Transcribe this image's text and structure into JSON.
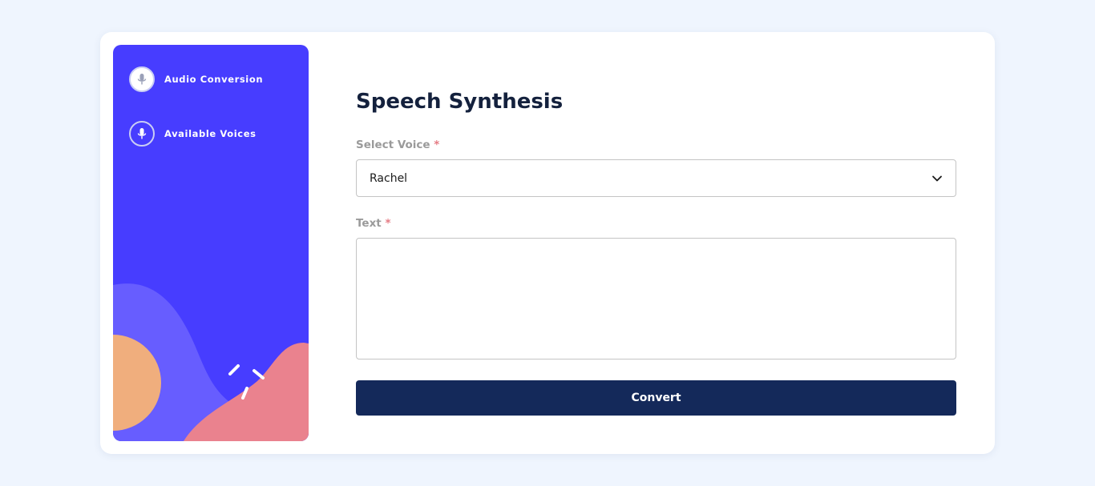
{
  "sidebar": {
    "items": [
      {
        "label": "Audio Conversion",
        "icon": "microphone-icon",
        "active": true
      },
      {
        "label": "Available Voices",
        "icon": "microphone-icon",
        "active": false
      }
    ]
  },
  "main": {
    "title": "Speech Synthesis",
    "voice_field": {
      "label": "Select Voice",
      "required_mark": "*",
      "value": "Rachel"
    },
    "text_field": {
      "label": "Text",
      "required_mark": "*",
      "value": "",
      "placeholder": ""
    },
    "convert_label": "Convert"
  },
  "colors": {
    "sidebar_bg": "#473dff",
    "button_bg": "#14295a",
    "title": "#14213d",
    "required": "#e57b84",
    "page_bg": "#eff5fe"
  }
}
